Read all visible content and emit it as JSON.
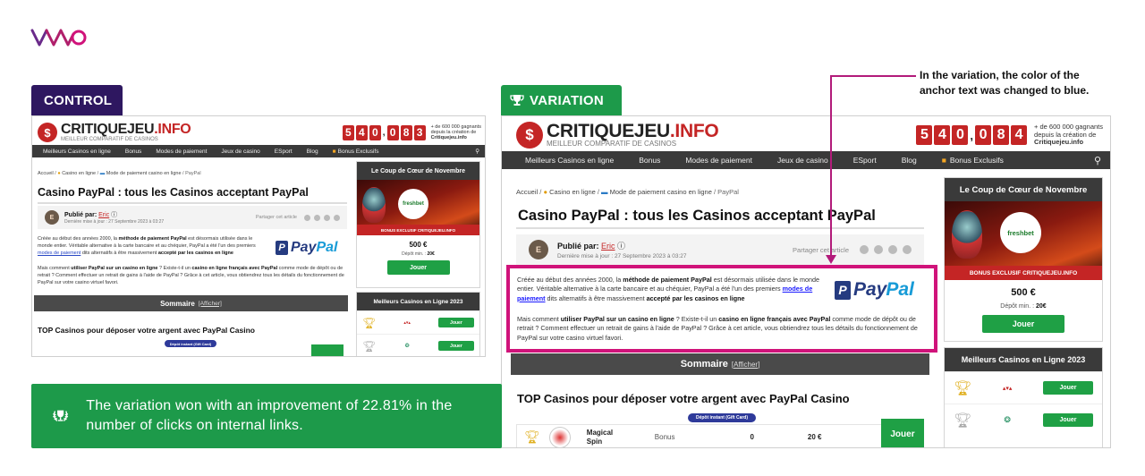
{
  "brand": {
    "logo_text": "VWO"
  },
  "labels": {
    "control": "CONTROL",
    "variation": "VARIATION"
  },
  "callout": "In the variation, the color of the anchor text was changed to blue.",
  "result": "The variation won with an improvement of 22.81% in the number of clicks on internal links.",
  "site": {
    "name_left": "CRITIQUEJEU",
    "name_right": ".INFO",
    "subtitle": "MEILLEUR COMPARATIF DE CASINOS",
    "counter_control": [
      "5",
      "4",
      "0",
      "0",
      "8",
      "3"
    ],
    "counter_variation": [
      "5",
      "4",
      "0",
      "0",
      "8",
      "4"
    ],
    "counter_note_1": "+ de 600 000 gagnants",
    "counter_note_2": "depuis la création de",
    "counter_note_3": "Critiquejeu.info",
    "nav": [
      "Meilleurs Casinos en ligne",
      "Bonus",
      "Modes de paiement",
      "Jeux de casino",
      "ESport",
      "Blog",
      "Bonus Exclusifs"
    ],
    "crumb_1": "Accueil",
    "crumb_2": "Casino en ligne",
    "crumb_3": "Mode de paiement casino en ligne",
    "crumb_4": "PayPal",
    "title": "Casino PayPal : tous les Casinos acceptant PayPal",
    "published_label": "Publié par:",
    "author": "Eric",
    "updated": "Dernière mise à jour : 27 Septembre 2023 à 03:27",
    "share": "Partager cet article",
    "para1_a": "Créée au début des années 2000, la ",
    "para1_b": "méthode de paiement PayPal",
    "para1_c": " est désormais utilisée dans le monde entier. Véritable alternative à la carte bancaire et au chéquier, PayPal a été l'un des premiers ",
    "para1_link": "modes de paiement",
    "para1_d": " dits alternatifs à être massivement ",
    "para1_e": "accepté par les casinos en ligne",
    "para2_a": "Mais comment ",
    "para2_b": "utiliser PayPal sur un casino en ligne",
    "para2_c": " ? Existe-t-il un ",
    "para2_d": "casino en ligne français avec PayPal",
    "para2_e": " comme mode de dépôt ou de retrait ? Comment effectuer un retrait de gains à l'aide de PayPal ? Grâce à cet article, vous obtiendrez tous les détails du fonctionnement de PayPal sur votre casino virtuel favori.",
    "paypal_1": "Pay",
    "paypal_2": "Pal",
    "sommaire": "Sommaire",
    "sommaire_toggle": "[Afficher]",
    "h2": "TOP Casinos pour déposer votre argent avec PayPal Casino",
    "depot_chip": "Dépôt instant (Gift Card)",
    "side_title": "Le Coup de Cœur de Novembre",
    "fresh": "freshbet",
    "bonus_ribbon": "BONUS EXCLUSIF CRITIQUEJEU.INFO",
    "amount": "500 €",
    "depot_label": "Dépôt min. :",
    "depot_value": "20€",
    "jouer": "Jouer",
    "best_title": "Meilleurs Casinos en Ligne 2023",
    "row_magical": "Magical Spin",
    "row_bonus": "Bonus",
    "row_zero": "0",
    "row_amount": "20 €"
  },
  "colors": {
    "control_tag": "#2e1760",
    "variation_tag": "#1d9a4a",
    "highlight": "#d0137a",
    "link_blue": "#1a1aff"
  }
}
